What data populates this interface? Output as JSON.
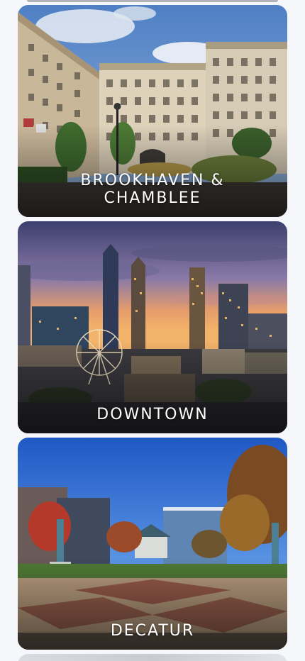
{
  "cards": [
    {
      "label": "BROOKHAVEN &\nCHAMBLEE",
      "scene": "apartment-buildings-photo"
    },
    {
      "label": "DOWNTOWN",
      "scene": "city-skyline-sunset-photo"
    },
    {
      "label": "DECATUR",
      "scene": "town-square-plaza-photo"
    }
  ]
}
